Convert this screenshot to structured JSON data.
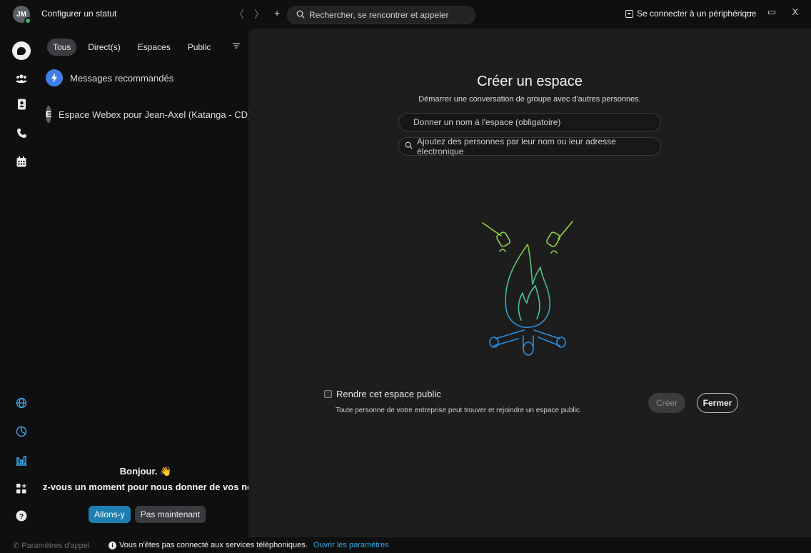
{
  "header": {
    "avatar_initials": "JM",
    "status_link": "Configurer un statut",
    "search_placeholder": "Rechercher, se rencontrer et appeler",
    "connect_device": "Se connecter à un périphérique",
    "window_controls": [
      "–",
      "▭",
      "X"
    ]
  },
  "rail": {
    "top_icons": [
      "messaging-icon",
      "teams-icon",
      "contacts-icon",
      "calls-icon",
      "calendar-icon"
    ],
    "bottom_icons": [
      "globe-icon",
      "clock-icon",
      "analytics-icon",
      "apps-icon",
      "help-icon"
    ]
  },
  "sidebar": {
    "filters": [
      {
        "label": "Tous",
        "selected": true
      },
      {
        "label": "Direct(s)",
        "selected": false
      },
      {
        "label": "Espaces",
        "selected": false
      },
      {
        "label": "Public",
        "selected": false
      }
    ],
    "conversations": [
      {
        "initial": "",
        "label": "Messages recommandés",
        "icon": "lightning-icon",
        "color": "#3f7ee8"
      },
      {
        "initial": "E",
        "label": "Espace Webex pour Jean-Axel (Katanga - CD)",
        "color": "#5b5f66"
      }
    ],
    "greeting": {
      "hello": "Bonjour.",
      "wave": "👋",
      "question": "z-vous un moment pour nous donner de vos nouvell",
      "primary_button": "Allons-y",
      "secondary_button": "Pas maintenant"
    }
  },
  "main": {
    "title": "Créer un espace",
    "subtitle": "Démarrer une conversation de groupe avec d'autres personnes.",
    "name_placeholder": "Donner un nom à l'espace (obligatoire)",
    "people_placeholder": "Ajoutez des personnes par leur nom ou leur adresse électronique",
    "public_label": "Rendre cet espace public",
    "public_description": "Toute personne de votre entreprise peut trouver et rejoindre un espace public.",
    "public_checked": false,
    "create_button": "Créer",
    "close_button": "Fermer"
  },
  "footer": {
    "call_settings": "Paramètres d'appel",
    "notice": "Vous n'êtes pas connecté aux services téléphoniques.",
    "notice_link": "Ouvrir les paramètres"
  }
}
